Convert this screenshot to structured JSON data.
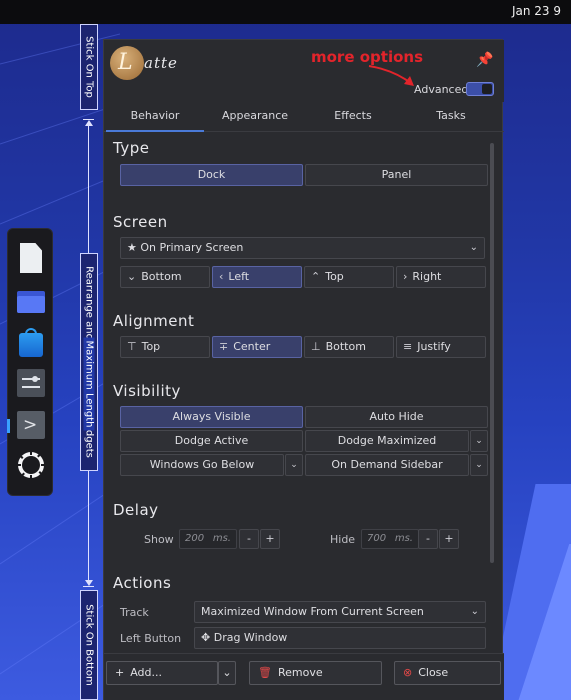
{
  "topbar": {
    "clock": "Jan 23  9"
  },
  "colors": {
    "accent": "#4a7ad8",
    "annotation": "#e3242b",
    "selected": "#39406b",
    "window_bg": "#2a2b2f"
  },
  "ruler": {
    "top_label": "Stick On Top",
    "middle_label": "Rearrange and configure your widgets",
    "bottom_label": "Stick On Bottom",
    "length_label": "Maximum Length"
  },
  "dock": {
    "items": [
      {
        "icon": "document-icon"
      },
      {
        "icon": "folder-icon"
      },
      {
        "icon": "store-icon"
      },
      {
        "icon": "settings-icon"
      },
      {
        "icon": "terminal-icon"
      },
      {
        "icon": "latte-gear-icon"
      }
    ]
  },
  "window": {
    "logo_letter": "L",
    "logo_rest": "atte",
    "annotation": "more options",
    "advanced_label": "Advanced",
    "advanced_enabled": true,
    "tabs": [
      "Behavior",
      "Appearance",
      "Effects",
      "Tasks"
    ],
    "active_tab": "Behavior",
    "type": {
      "title": "Type",
      "options": [
        "Dock",
        "Panel"
      ],
      "selected": "Dock"
    },
    "screen": {
      "title": "Screen",
      "screen_select": "On Primary Screen",
      "edges": [
        "Bottom",
        "Left",
        "Top",
        "Right"
      ],
      "selected_edge": "Left"
    },
    "alignment": {
      "title": "Alignment",
      "options": [
        "Top",
        "Center",
        "Bottom",
        "Justify"
      ],
      "selected": "Center"
    },
    "visibility": {
      "title": "Visibility",
      "options": [
        "Always Visible",
        "Auto Hide",
        "Dodge Active",
        "Dodge Maximized",
        "Windows Go Below",
        "On Demand Sidebar"
      ],
      "selected": "Always Visible"
    },
    "delay": {
      "title": "Delay",
      "show_label": "Show",
      "show_value": "200",
      "hide_label": "Hide",
      "hide_value": "700",
      "unit": "ms.",
      "minus": "-",
      "plus": "+"
    },
    "actions": {
      "title": "Actions",
      "track_label": "Track",
      "track_value": "Maximized Window From Current Screen",
      "left_button_label": "Left Button",
      "left_button_value": "Drag Window"
    },
    "footer": {
      "add": "Add...",
      "remove": "Remove",
      "close": "Close"
    }
  }
}
